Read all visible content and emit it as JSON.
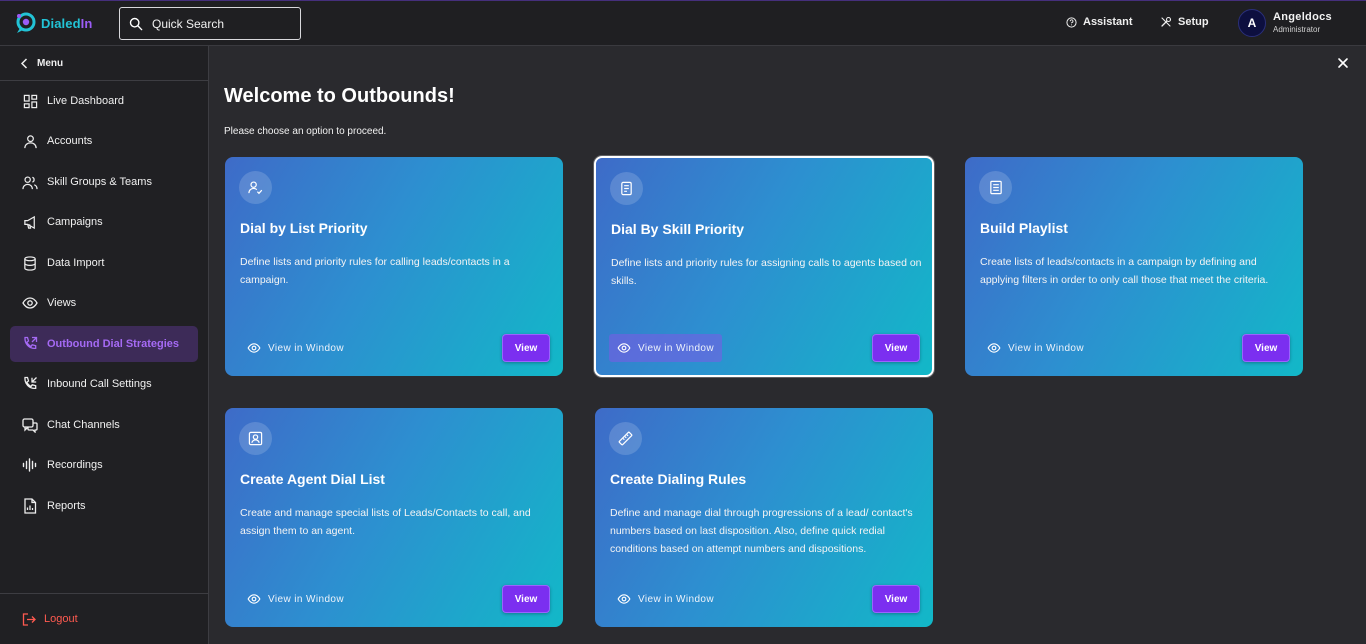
{
  "app": {
    "logo_main": "Dialed",
    "logo_accent": "In",
    "brand_color": "#22c3d6",
    "accent_color": "#7b2ff0"
  },
  "search": {
    "label": "Quick Search"
  },
  "topbar": {
    "assistant_label": "Assistant",
    "setup_label": "Setup"
  },
  "user": {
    "initial": "A",
    "name": "Angeldocs",
    "role": "Administrator"
  },
  "sidebar": {
    "menu_label": "Menu",
    "items": [
      {
        "label": "Live Dashboard",
        "icon": "dashboard-icon"
      },
      {
        "label": "Accounts",
        "icon": "user-icon"
      },
      {
        "label": "Skill Groups & Teams",
        "icon": "users-icon"
      },
      {
        "label": "Campaigns",
        "icon": "megaphone-icon"
      },
      {
        "label": "Data Import",
        "icon": "database-icon"
      },
      {
        "label": "Views",
        "icon": "eye-icon"
      },
      {
        "label": "Outbound Dial Strategies",
        "icon": "phone-outgoing-icon",
        "active": true
      },
      {
        "label": "Inbound Call Settings",
        "icon": "phone-incoming-icon"
      },
      {
        "label": "Chat Channels",
        "icon": "chat-icon"
      },
      {
        "label": "Recordings",
        "icon": "waveform-icon"
      },
      {
        "label": "Reports",
        "icon": "report-icon"
      }
    ],
    "logout_label": "Logout"
  },
  "main": {
    "title": "Welcome to Outbounds!",
    "subtitle": "Please choose an option to proceed.",
    "cards": [
      {
        "title": "Dial by List Priority",
        "description": "Define lists and priority rules for calling leads/contacts in a campaign.",
        "window_label": "View in Window",
        "view_label": "View",
        "icon": "user-check-icon"
      },
      {
        "title": "Dial By Skill Priority",
        "description": "Define lists and priority rules for assigning calls to agents based on skills.",
        "window_label": "View in Window",
        "view_label": "View",
        "icon": "document-icon",
        "selected": true
      },
      {
        "title": "Build Playlist",
        "description": "Create lists of leads/contacts in a campaign by defining and applying filters in order to only call those that meet the criteria.",
        "window_label": "View in Window",
        "view_label": "View",
        "icon": "list-icon"
      },
      {
        "title": "Create Agent Dial List",
        "description": "Create and manage special lists of Leads/Contacts to call, and assign them to an agent.",
        "window_label": "View in Window",
        "view_label": "View",
        "icon": "contact-card-icon"
      },
      {
        "title": "Create Dialing Rules",
        "description": "Define and manage dial through progressions of a lead/ contact's numbers based on last disposition. Also, define quick redial conditions based on attempt numbers and dispositions.",
        "window_label": "View in Window",
        "view_label": "View",
        "icon": "ruler-icon"
      }
    ]
  }
}
